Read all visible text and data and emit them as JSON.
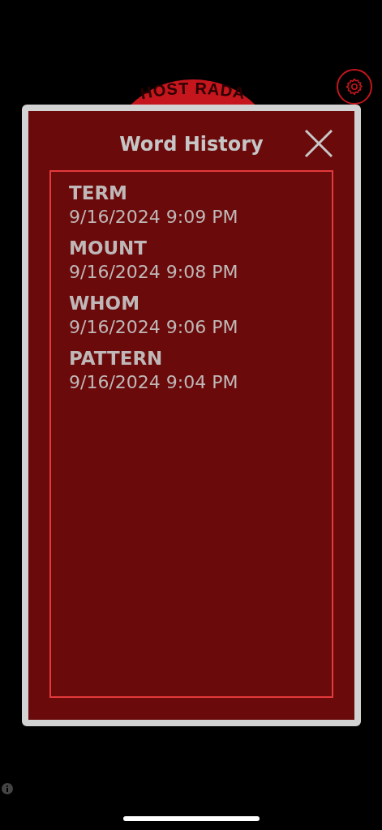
{
  "logo": {
    "text": "HOST RADA"
  },
  "dialog": {
    "title": "Word History",
    "entries": [
      {
        "word": "TERM",
        "time": "9/16/2024 9:09 PM"
      },
      {
        "word": "MOUNT",
        "time": "9/16/2024 9:08 PM"
      },
      {
        "word": "WHOM",
        "time": "9/16/2024 9:06 PM"
      },
      {
        "word": "PATTERN",
        "time": "9/16/2024 9:04 PM"
      }
    ]
  }
}
